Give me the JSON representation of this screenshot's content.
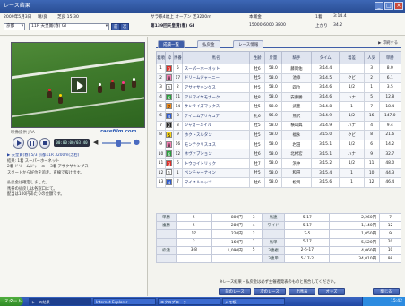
{
  "window": {
    "title": "レース結果"
  },
  "infobar": {
    "row1_left": [
      "2009年5月3日",
      "晴/良",
      "芝良 15:30"
    ],
    "race_select": "11R 天皇賞(春) GI",
    "venue_select": "京都",
    "race_title": "第139回天皇賞(春) GI",
    "race_conditions": "サラ系4歳上 オープン 芝3200m",
    "prize_label": "本賞金",
    "prize_value": "15000 6000 3800",
    "distance_label": "1着",
    "distance_value": "3:14.4",
    "time_label": "上がり",
    "time_value": "34.2",
    "prev_btn": "前",
    "next_btn": "次"
  },
  "video": {
    "caption": "映像提供 JRA",
    "logo": "racefilm.com",
    "time_display": "00:00:00/03:40"
  },
  "notes": {
    "headline": "▶ 天皇賞(春) 5/3 京都11R 3200m(芝右)",
    "lines": [
      "結果: 1着 スーパーホーネット",
      "2着 ドリームジャーニー  3着 アサクサキングス",
      "スタートから好位を追走、直線で抜け出す。"
    ],
    "p2": [
      "払戻金は確定しました。",
      "馬券の払戻しは各窓口にて。",
      "配当は100円あたりの金額です。"
    ]
  },
  "tabs": [
    {
      "label": "成績一覧",
      "active": true
    },
    {
      "label": "払戻金",
      "active": false
    },
    {
      "label": "レース情報",
      "active": false
    }
  ],
  "tab_note": "▶ 印刷する",
  "runners": {
    "headers": [
      "着順",
      "枠",
      "馬番",
      "馬名",
      "性齢",
      "斤量",
      "騎手",
      "タイム",
      "着差",
      "人気",
      "単勝"
    ],
    "rows": [
      [
        "1",
        "3",
        "5",
        "スーパーホーネット",
        "牡6",
        "58.0",
        "藤岡佑",
        "3:14.4",
        "",
        "3",
        "8.0"
      ],
      [
        "2",
        "8",
        "17",
        "ドリームジャーニー",
        "牡5",
        "58.0",
        "池添",
        "3:14.5",
        "クビ",
        "2",
        "6.1"
      ],
      [
        "3",
        "1",
        "2",
        "アサクサキングス",
        "牡5",
        "58.0",
        "四位",
        "3:14.6",
        "1/2",
        "1",
        "3.5"
      ],
      [
        "4",
        "6",
        "11",
        "アドマイヤモナーク",
        "牡8",
        "58.0",
        "安藤勝",
        "3:14.6",
        "ハナ",
        "5",
        "12.8"
      ],
      [
        "5",
        "7",
        "14",
        "サンライズマックス",
        "牡5",
        "58.0",
        "武豊",
        "3:14.8",
        "1",
        "7",
        "18.4"
      ],
      [
        "6",
        "4",
        "8",
        "テイエムプリキュア",
        "牝6",
        "56.0",
        "熊沢",
        "3:14.9",
        "1/2",
        "16",
        "147.0"
      ],
      [
        "7",
        "2",
        "3",
        "ジャガーメイル",
        "牡5",
        "58.0",
        "横山典",
        "3:14.9",
        "ハナ",
        "4",
        "9.4"
      ],
      [
        "8",
        "5",
        "9",
        "ホクトスルタン",
        "牡5",
        "58.0",
        "福永",
        "3:15.0",
        "クビ",
        "8",
        "21.6"
      ],
      [
        "9",
        "8",
        "16",
        "モンテクリスエス",
        "牡5",
        "58.0",
        "岩田",
        "3:15.1",
        "1/2",
        "6",
        "14.2"
      ],
      [
        "10",
        "6",
        "12",
        "ネヴァブション",
        "牡6",
        "58.0",
        "北村宏",
        "3:15.1",
        "ハナ",
        "9",
        "32.7"
      ],
      [
        "11",
        "3",
        "6",
        "トウカイトリック",
        "牡7",
        "58.0",
        "浜中",
        "3:15.2",
        "1/2",
        "11",
        "48.0"
      ],
      [
        "12",
        "1",
        "1",
        "ベンチャーナイン",
        "牡5",
        "58.0",
        "和田",
        "3:15.4",
        "1",
        "10",
        "44.3"
      ],
      [
        "13",
        "4",
        "7",
        "マイネルキッツ",
        "牡6",
        "58.0",
        "松岡",
        "3:15.6",
        "1",
        "12",
        "46.4"
      ]
    ]
  },
  "payouts": {
    "rows": [
      [
        "単勝",
        "5",
        "800円",
        "3",
        "馬連",
        "5-17",
        "2,260円",
        "7"
      ],
      [
        "複勝",
        "5",
        "280円",
        "4",
        "ワイド",
        "5-17",
        "1,140円",
        "12"
      ],
      [
        "",
        "17",
        "220円",
        "2",
        "",
        "2-5",
        "1,050円",
        "9"
      ],
      [
        "",
        "2",
        "160円",
        "1",
        "馬単",
        "5-17",
        "5,520円",
        "20"
      ],
      [
        "枠連",
        "3-8",
        "1,090円",
        "5",
        "3連複",
        "2-5-17",
        "4,060円",
        "10"
      ],
      [
        "",
        "",
        "",
        "",
        "3連単",
        "5-17-2",
        "34,010円",
        "98"
      ]
    ]
  },
  "footnote": "※レース結果・払戻金は必ず主催者発表のものと照合してください。",
  "bottom_buttons": [
    "前のレース",
    "次のレース",
    "出馬表",
    "オッズ",
    "閉じる"
  ],
  "taskbar": {
    "start": "スタート",
    "tasks": [
      "レース結果",
      "Internet Explorer",
      "エクスプローラ",
      "メモ帳"
    ],
    "clock": "15:42"
  }
}
